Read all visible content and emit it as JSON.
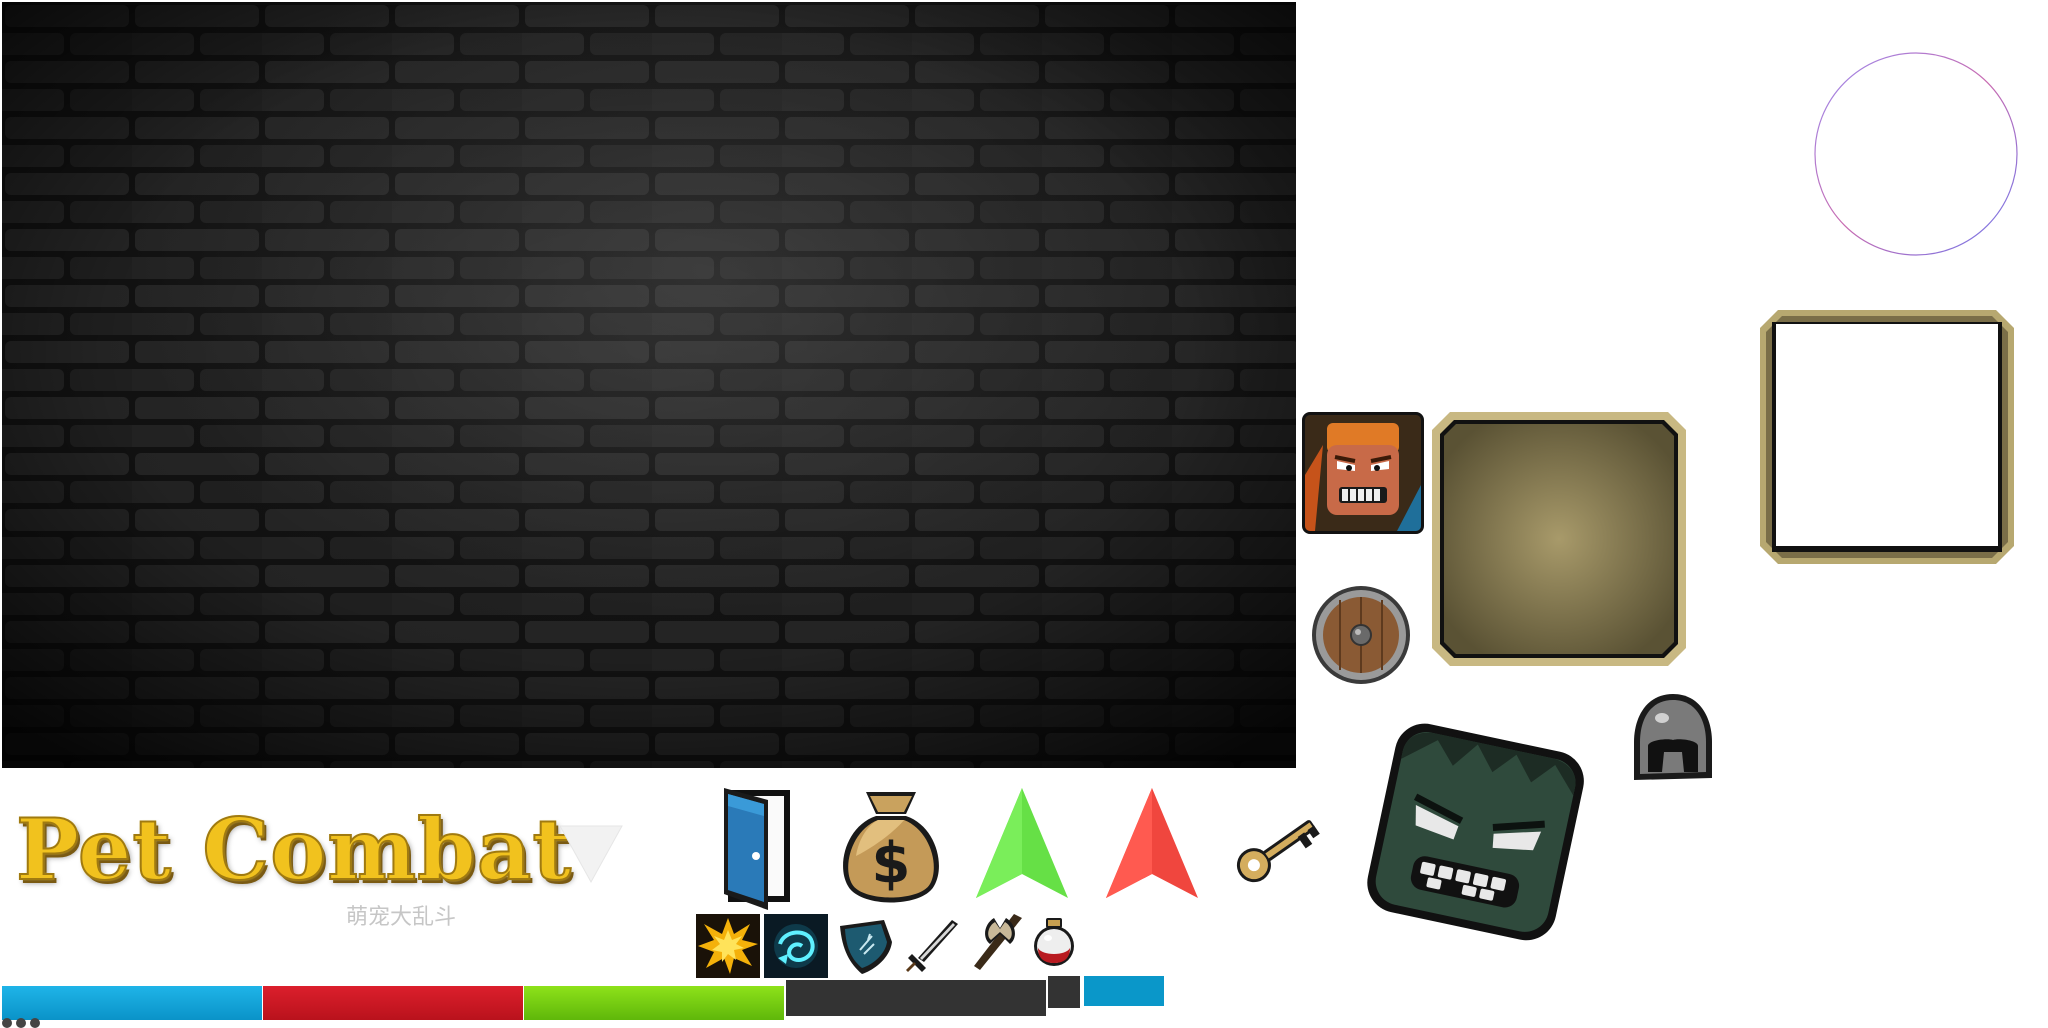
{
  "game": {
    "title": "Pet Combat",
    "subtitle": "萌宠大乱斗"
  },
  "sprites": [
    {
      "name": "brick-wall-background",
      "kind": "background"
    },
    {
      "name": "hero-portrait",
      "kind": "avatar"
    },
    {
      "name": "round-wooden-shield",
      "kind": "item"
    },
    {
      "name": "tan-panel-frame",
      "kind": "frame"
    },
    {
      "name": "hollow-gold-frame",
      "kind": "frame"
    },
    {
      "name": "outline-circle",
      "kind": "marker"
    },
    {
      "name": "white-down-triangle",
      "kind": "marker"
    },
    {
      "name": "blue-door",
      "kind": "exit"
    },
    {
      "name": "money-bag",
      "kind": "loot"
    },
    {
      "name": "green-up-arrow",
      "kind": "indicator"
    },
    {
      "name": "red-up-arrow",
      "kind": "indicator"
    },
    {
      "name": "gold-key",
      "kind": "item"
    },
    {
      "name": "zombie-head",
      "kind": "enemy"
    },
    {
      "name": "iron-helmet",
      "kind": "armor"
    }
  ],
  "skills": [
    {
      "name": "explosion-skill",
      "icon": "explosion-icon"
    },
    {
      "name": "spirit-skill",
      "icon": "spirit-icon"
    },
    {
      "name": "shield-skill",
      "icon": "shield-icon"
    },
    {
      "name": "sword-skill",
      "icon": "sword-icon"
    },
    {
      "name": "axe-skill",
      "icon": "axe-icon"
    },
    {
      "name": "potion-skill",
      "icon": "potion-icon"
    }
  ],
  "bars": {
    "hp_color": "#0a93c8",
    "rage_color": "#b9121c",
    "xp_color": "#5fb70a",
    "track_color": "#333333",
    "accent_color": "#0a97c9"
  },
  "colors": {
    "title_gold": "#f1c21e",
    "frame_gold": "#b7a870",
    "panel_tan": "#6f6648"
  }
}
